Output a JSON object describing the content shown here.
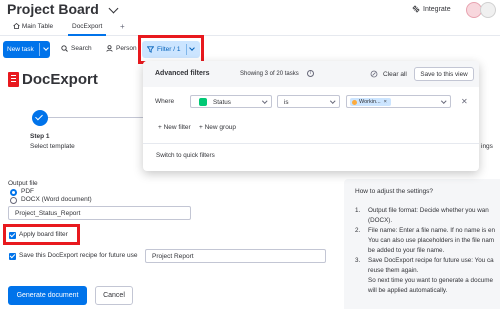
{
  "header": {
    "board_title": "Project Board",
    "integrate_label": "Integrate",
    "tabs": [
      {
        "label": "Main Table"
      },
      {
        "label": "DocExport"
      }
    ],
    "add_tab": "+"
  },
  "toolbar": {
    "new_task": "New task",
    "search": "Search",
    "person": "Person",
    "filter": "Filter / 1"
  },
  "filter_popup": {
    "title": "Advanced filters",
    "count_text": "Showing 3 of 20 tasks",
    "clear_all": "Clear all",
    "save_view": "Save to this view",
    "where_label": "Where",
    "column": "Status",
    "condition": "is",
    "value": "Workin...",
    "new_filter": "+ New filter",
    "new_group": "+ New group",
    "switch_quick": "Switch to quick filters"
  },
  "docexport": {
    "title": "DocExport",
    "step_number": "Step 1",
    "step_desc": "Select template",
    "step_right_partial": "ings",
    "output_label": "Output file",
    "option_pdf": "PDF",
    "option_docx": "DOCX (Word document)",
    "selected_format": "PDF",
    "filename": "Project_Status_Report",
    "apply_filter_label": "Apply board filter",
    "apply_filter_checked": true,
    "save_recipe_label": "Save this DocExport recipe for future use",
    "save_recipe_checked": true,
    "recipe_name": "Project Report",
    "generate": "Generate document",
    "cancel": "Cancel"
  },
  "help": {
    "title": "How to adjust the settings?",
    "items": [
      {
        "num": "1.",
        "lines": [
          "Output file format: Decide whether you wan",
          "(DOCX)."
        ]
      },
      {
        "num": "2.",
        "lines": [
          "File name: Enter a file name. If no name is en",
          "You can also use placeholders in the file nam",
          "be added to your file name."
        ]
      },
      {
        "num": "3.",
        "lines": [
          "Save DocExport recipe for future use: You ca",
          "reuse them again.",
          "So next time you want to generate a docume",
          "will be applied automatically."
        ]
      }
    ]
  },
  "colors": {
    "accent": "#0073ea",
    "highlight": "#e8191e",
    "status_green": "#00c875",
    "working_orange": "#fdab3d"
  }
}
